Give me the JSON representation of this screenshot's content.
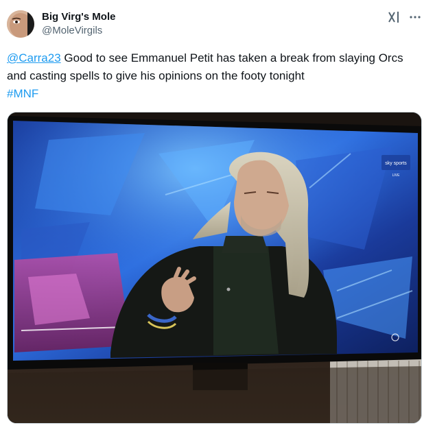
{
  "author": {
    "display_name": "Big Virg's Mole",
    "handle": "@MoleVirgils"
  },
  "tweet": {
    "mention": "@Carra23",
    "text": " Good to see Emmanuel Petit has taken a break from slaying Orcs and casting spells to give his opinions on the footy tonight",
    "hashtag": "#MNF"
  },
  "media": {
    "broadcast_logo_text": "sky sports",
    "broadcast_live_text": "LIVE"
  },
  "icons": {
    "grok": "grok-icon",
    "more": "more-options-icon"
  },
  "colors": {
    "link": "#1d9bf0",
    "text": "#0f1419",
    "muted": "#536471"
  }
}
